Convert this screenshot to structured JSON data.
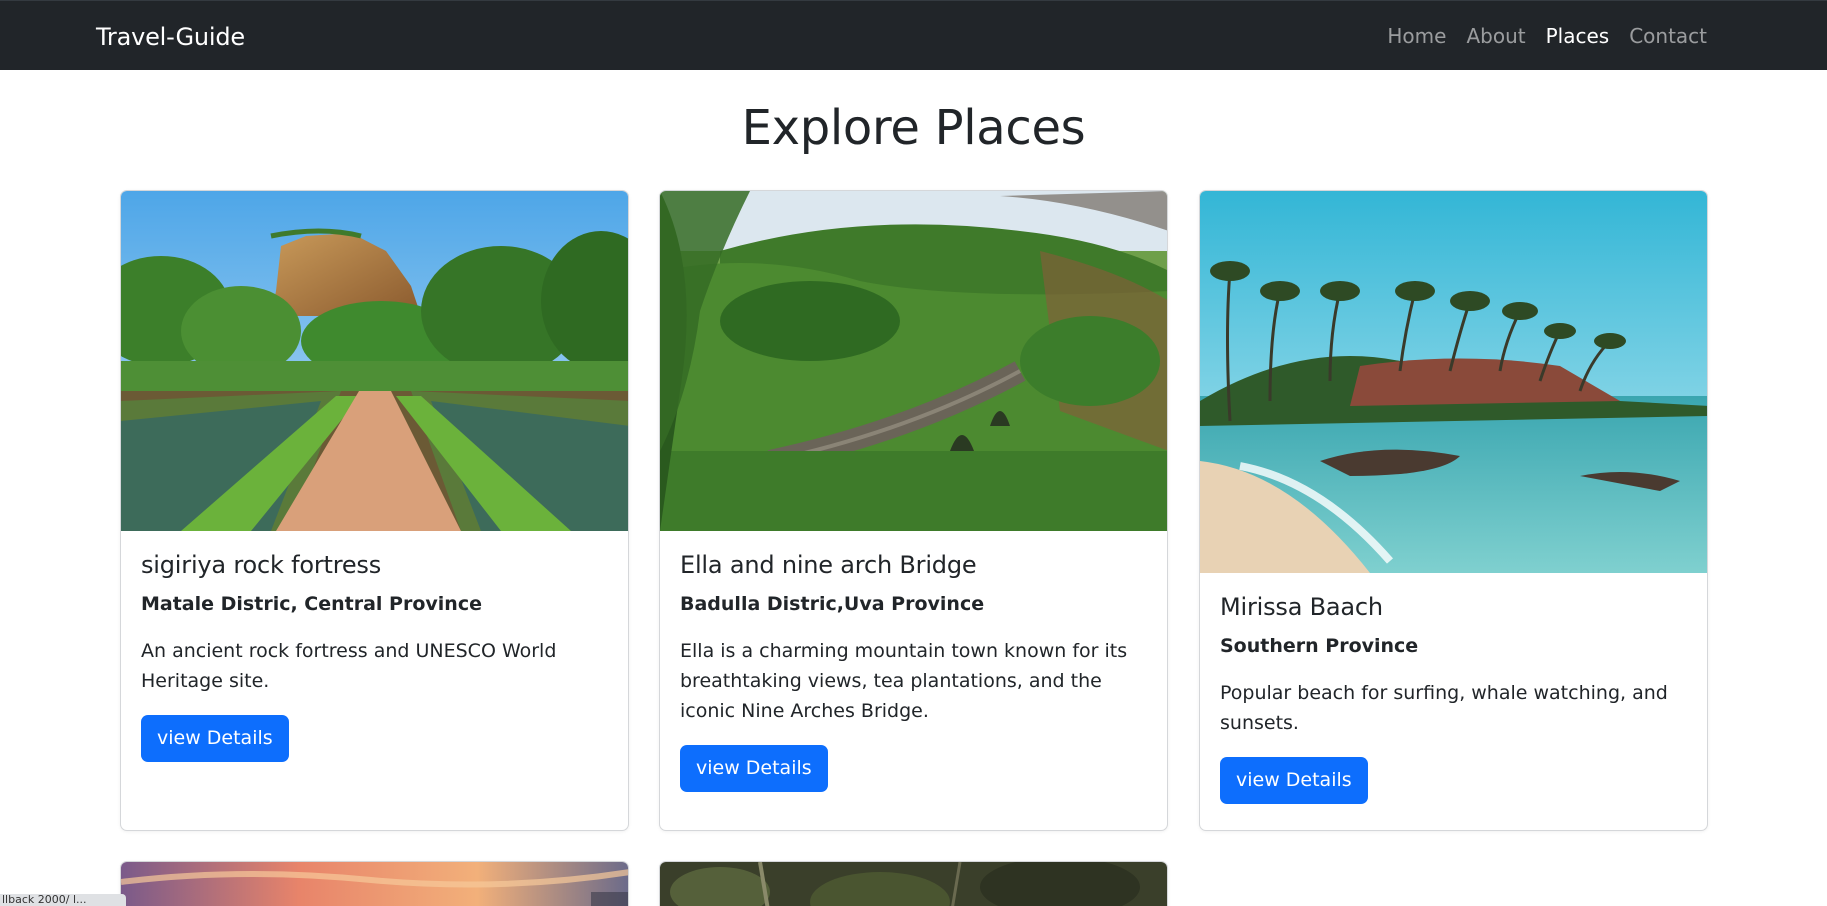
{
  "navbar": {
    "brand": "Travel-Guide",
    "links": [
      {
        "label": "Home"
      },
      {
        "label": "About"
      },
      {
        "label": "Places"
      },
      {
        "label": "Contact"
      }
    ]
  },
  "main": {
    "title": "Explore Places",
    "cards": [
      {
        "title": "sigiriya rock fortress",
        "subtitle": "Matale Distric, Central Province",
        "text": "An ancient rock fortress and UNESCO World Heritage site.",
        "button": "view Details"
      },
      {
        "title": "Ella and nine arch Bridge",
        "subtitle": "Badulla Distric,Uva Province",
        "text": "Ella is a charming mountain town known for its breathtaking views, tea plantations, and the iconic Nine Arches Bridge.",
        "button": "view Details"
      },
      {
        "title": "Mirissa Baach",
        "subtitle": "Southern Province",
        "text": "Popular beach for surfing, whale watching, and sunsets.",
        "button": "view Details"
      }
    ]
  },
  "status_bar": "llback 2000/  l..."
}
